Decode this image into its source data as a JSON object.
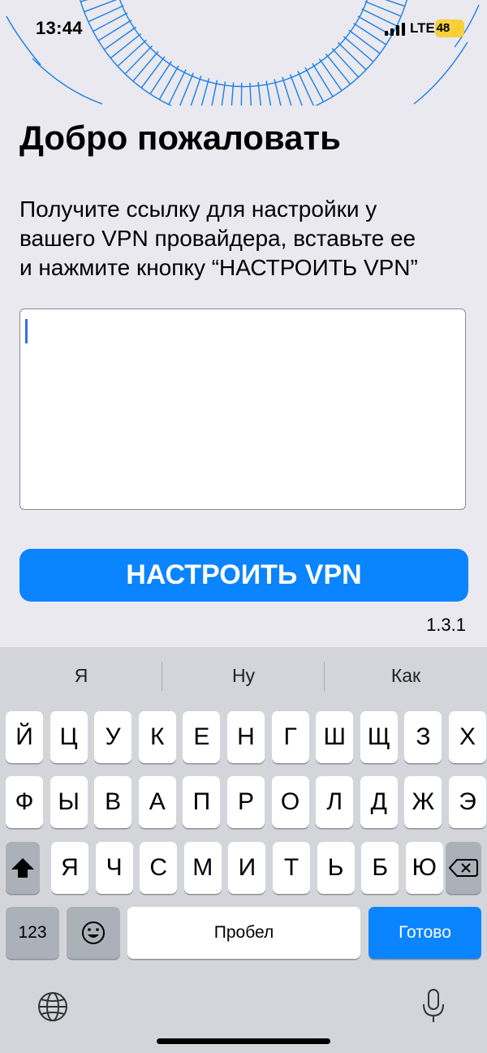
{
  "status_bar": {
    "time": "13:44",
    "network": "LTE",
    "battery": "48"
  },
  "welcome": {
    "title": "Добро пожаловать",
    "description_lines": [
      "Получите ссылку для настройки у",
      "вашего VPN провайдера, вставьте ее",
      "и нажмите кнопку “НАСТРОИТЬ VPN”"
    ]
  },
  "config_input": {
    "value": "",
    "placeholder": ""
  },
  "setup_button": {
    "label": "НАСТРОИТЬ VPN"
  },
  "version": "1.3.1",
  "keyboard": {
    "suggestions": [
      "Я",
      "Ну",
      "Как"
    ],
    "row1": [
      "Й",
      "Ц",
      "У",
      "К",
      "Е",
      "Н",
      "Г",
      "Ш",
      "Щ",
      "З",
      "Х"
    ],
    "row2": [
      "Ф",
      "Ы",
      "В",
      "А",
      "П",
      "Р",
      "О",
      "Л",
      "Д",
      "Ж",
      "Э"
    ],
    "row3": [
      "Я",
      "Ч",
      "С",
      "М",
      "И",
      "Т",
      "Ь",
      "Б",
      "Ю"
    ],
    "numbers_label": "123",
    "space_label": "Пробел",
    "done_label": "Готово"
  },
  "colors": {
    "accent": "#0a84ff",
    "background": "#e9e9ef",
    "keyboard": "#d3d5db",
    "battery": "#f5d13b"
  }
}
